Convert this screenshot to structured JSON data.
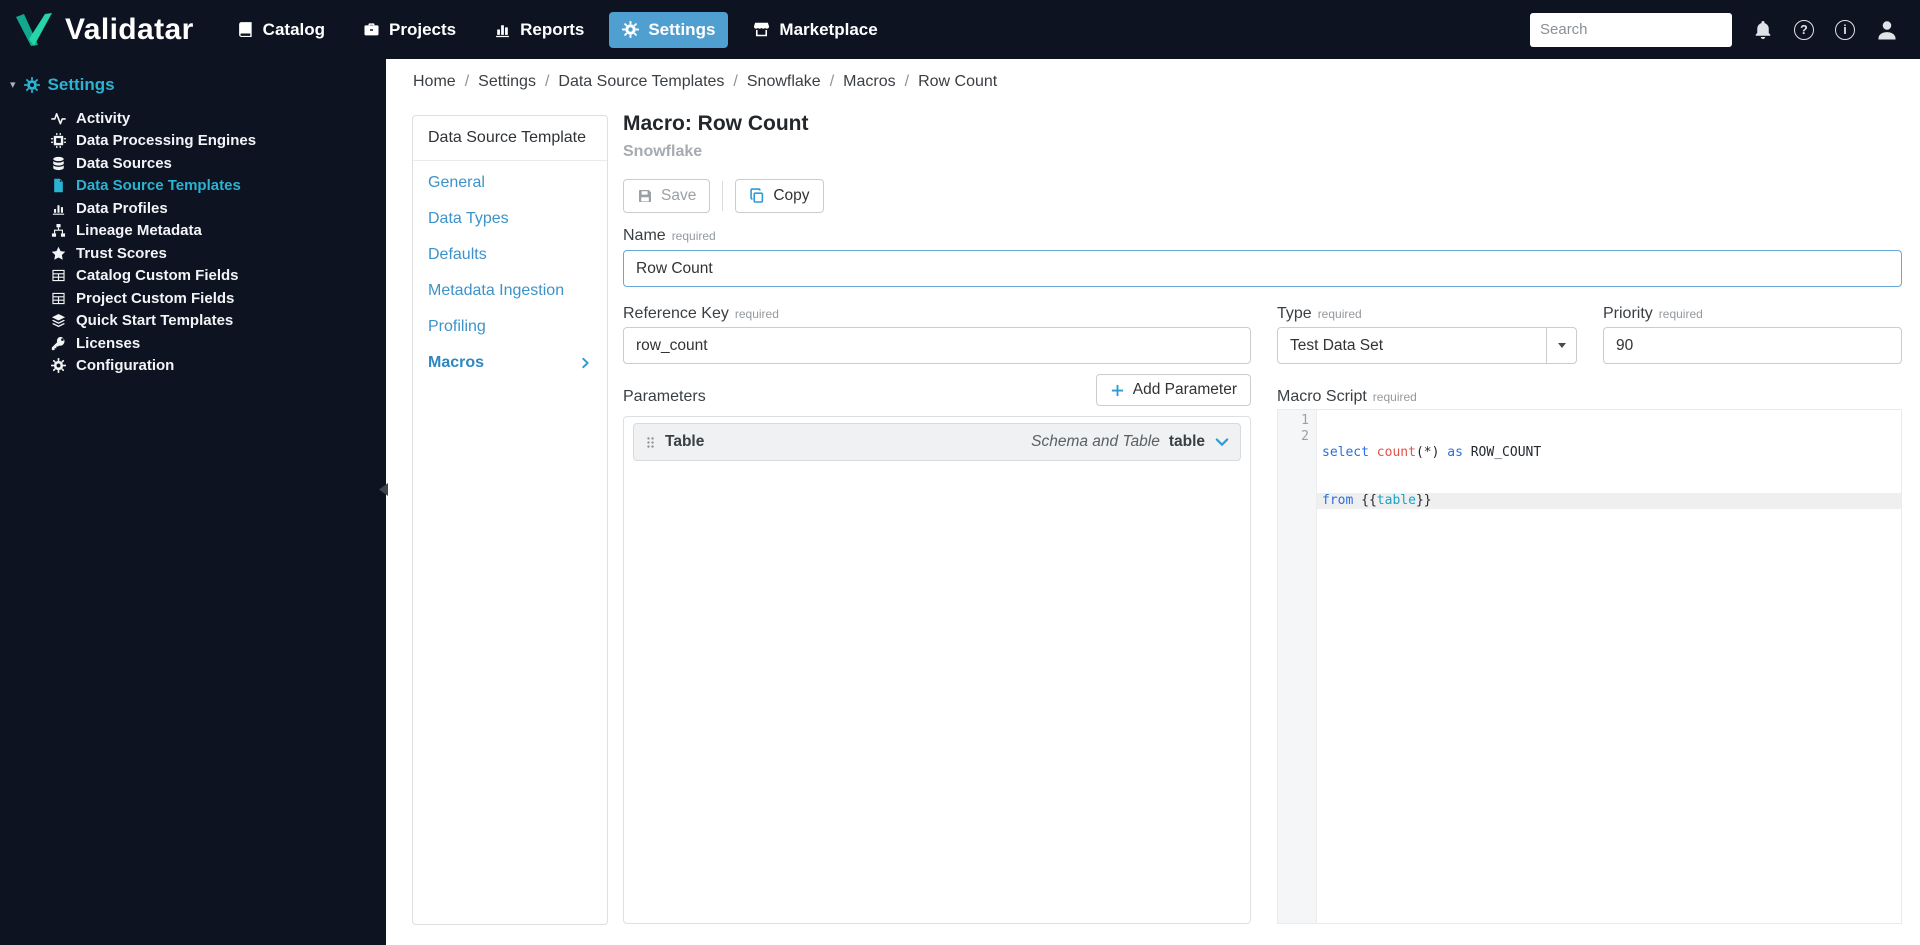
{
  "navbar": {
    "brand": "Validatar",
    "items": [
      {
        "label": "Catalog"
      },
      {
        "label": "Projects"
      },
      {
        "label": "Reports"
      },
      {
        "label": "Settings"
      },
      {
        "label": "Marketplace"
      }
    ],
    "search_placeholder": "Search"
  },
  "icons": {
    "help": "?",
    "info": "i",
    "collapse_caret": "▾"
  },
  "sidebar": {
    "title": "Settings",
    "items": [
      {
        "label": "Activity"
      },
      {
        "label": "Data Processing Engines"
      },
      {
        "label": "Data Sources"
      },
      {
        "label": "Data Source Templates"
      },
      {
        "label": "Data Profiles"
      },
      {
        "label": "Lineage Metadata"
      },
      {
        "label": "Trust Scores"
      },
      {
        "label": "Catalog Custom Fields"
      },
      {
        "label": "Project Custom Fields"
      },
      {
        "label": "Quick Start Templates"
      },
      {
        "label": "Licenses"
      },
      {
        "label": "Configuration"
      }
    ]
  },
  "breadcrumb": {
    "separator": "/",
    "items": [
      "Home",
      "Settings",
      "Data Source Templates",
      "Snowflake",
      "Macros",
      "Row Count"
    ]
  },
  "subnav": {
    "header": "Data Source Template",
    "items": [
      "General",
      "Data Types",
      "Defaults",
      "Metadata Ingestion",
      "Profiling",
      "Macros"
    ]
  },
  "page": {
    "title": "Macro: Row Count",
    "subtitle": "Snowflake",
    "save_label": "Save",
    "copy_label": "Copy"
  },
  "form": {
    "required_badge": "required",
    "name": {
      "label": "Name",
      "value": "Row Count"
    },
    "reference_key": {
      "label": "Reference Key",
      "value": "row_count"
    },
    "type": {
      "label": "Type",
      "value": "Test Data Set"
    },
    "priority": {
      "label": "Priority",
      "value": "90"
    }
  },
  "parameters": {
    "label": "Parameters",
    "add_button": "Add Parameter",
    "rows": [
      {
        "name": "Table",
        "type_hint": "Schema and Table",
        "type": "table"
      }
    ]
  },
  "macro_script": {
    "label": "Macro Script",
    "line_numbers": [
      "1",
      "2"
    ],
    "code": {
      "l1_kw1": "select ",
      "l1_fn": "count",
      "l1_p1": "(*) ",
      "l1_kw2": "as",
      "l1_id": " ROW_COUNT",
      "l2_kw": "from ",
      "l2_open": "{{",
      "l2_var": "table",
      "l2_close": "}}"
    }
  }
}
